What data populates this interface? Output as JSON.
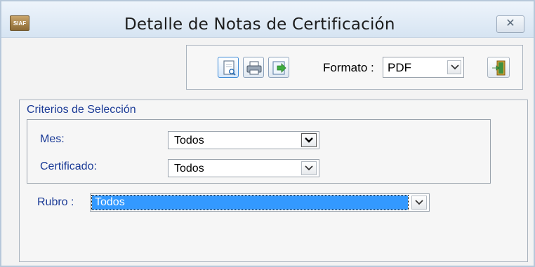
{
  "window": {
    "title": "Detalle de Notas de Certificación",
    "app_icon_text": "SIAF",
    "close_glyph": "✕"
  },
  "toolbar": {
    "preview_icon": "preview-icon",
    "print_icon": "printer-icon",
    "export_icon": "export-icon",
    "format_label": "Formato :",
    "format_value": "PDF",
    "exit_icon": "exit-door-icon"
  },
  "criteria": {
    "title": "Criterios de Selección",
    "mes": {
      "label": "Mes:",
      "value": "Todos"
    },
    "certificado": {
      "label": "Certificado:",
      "value": "Todos"
    },
    "rubro": {
      "label": "Rubro  :",
      "value": "Todos"
    }
  },
  "colors": {
    "label_blue": "#1a3a96",
    "selection_blue": "#3399ff"
  }
}
